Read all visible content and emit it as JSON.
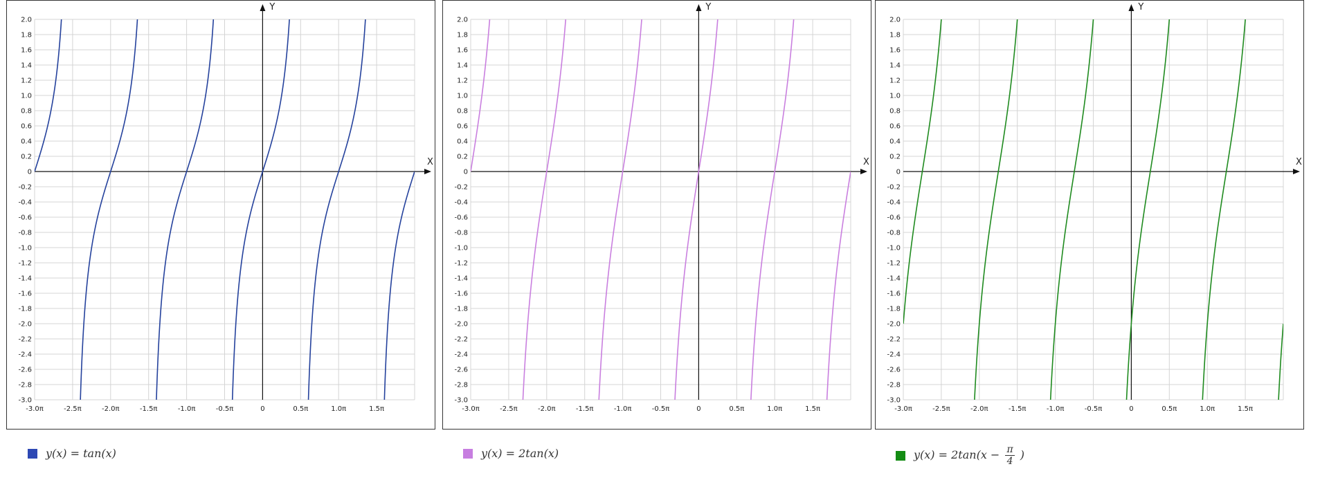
{
  "axis_labels": {
    "x": "X",
    "y": "Y"
  },
  "chart_data": [
    {
      "type": "line",
      "function": "tan",
      "multiplier": 1,
      "phase_pi": 0,
      "xlim": [
        -3.0,
        2.0
      ],
      "ylim": [
        -3.0,
        2.0
      ],
      "grid": true,
      "x_tick_labels": [
        "-3.0π",
        "-2.5π",
        "-2.0π",
        "-1.5π",
        "-1.0π",
        "-0.5π",
        "0",
        "0.5π",
        "1.0π",
        "1.5π"
      ],
      "x_tick_values": [
        -3.0,
        -2.5,
        -2.0,
        -1.5,
        -1.0,
        -0.5,
        0,
        0.5,
        1.0,
        1.5
      ],
      "y_tick_labels": [
        "2.0",
        "1.8",
        "1.6",
        "1.4",
        "1.2",
        "1.0",
        "0.8",
        "0.6",
        "0.4",
        "0.2",
        "0",
        "-0.2",
        "-0.4",
        "-0.6",
        "-0.8",
        "-1.0",
        "-1.2",
        "-1.4",
        "-1.6",
        "-1.8",
        "-2.0",
        "-2.2",
        "-2.4",
        "-2.6",
        "-2.8",
        "-3.0"
      ],
      "y_tick_values": [
        2.0,
        1.8,
        1.6,
        1.4,
        1.2,
        1.0,
        0.8,
        0.6,
        0.4,
        0.2,
        0,
        -0.2,
        -0.4,
        -0.6,
        -0.8,
        -1.0,
        -1.2,
        -1.4,
        -1.6,
        -1.8,
        -2.0,
        -2.2,
        -2.4,
        -2.6,
        -2.8,
        -3.0
      ],
      "color": "#24419c",
      "legend": {
        "prefix": "y(x) = tan(x)",
        "frac_num": "",
        "frac_den": "",
        "suffix": "",
        "swatch_color": "#2d48b4"
      }
    },
    {
      "type": "line",
      "function": "tan",
      "multiplier": 2,
      "phase_pi": 0,
      "xlim": [
        -3.0,
        2.0
      ],
      "ylim": [
        -3.0,
        2.0
      ],
      "grid": true,
      "x_tick_labels": [
        "-3.0π",
        "-2.5π",
        "-2.0π",
        "-1.5π",
        "-1.0π",
        "-0.5π",
        "0",
        "0.5π",
        "1.0π",
        "1.5π"
      ],
      "x_tick_values": [
        -3.0,
        -2.5,
        -2.0,
        -1.5,
        -1.0,
        -0.5,
        0,
        0.5,
        1.0,
        1.5
      ],
      "y_tick_labels": [
        "2.0",
        "1.8",
        "1.6",
        "1.4",
        "1.2",
        "1.0",
        "0.8",
        "0.6",
        "0.4",
        "0.2",
        "0",
        "-0.2",
        "-0.4",
        "-0.6",
        "-0.8",
        "-1.0",
        "-1.2",
        "-1.4",
        "-1.6",
        "-1.8",
        "-2.0",
        "-2.2",
        "-2.4",
        "-2.6",
        "-2.8",
        "-3.0"
      ],
      "y_tick_values": [
        2.0,
        1.8,
        1.6,
        1.4,
        1.2,
        1.0,
        0.8,
        0.6,
        0.4,
        0.2,
        0,
        -0.2,
        -0.4,
        -0.6,
        -0.8,
        -1.0,
        -1.2,
        -1.4,
        -1.6,
        -1.8,
        -2.0,
        -2.2,
        -2.4,
        -2.6,
        -2.8,
        -3.0
      ],
      "color": "#c97fdf",
      "legend": {
        "prefix": "y(x) = 2tan(x)",
        "frac_num": "",
        "frac_den": "",
        "suffix": "",
        "swatch_color": "#c77ee0"
      }
    },
    {
      "type": "line",
      "function": "tan",
      "multiplier": 2,
      "phase_pi": -0.25,
      "xlim": [
        -3.0,
        2.0
      ],
      "ylim": [
        -3.0,
        2.0
      ],
      "grid": true,
      "x_tick_labels": [
        "-3.0π",
        "-2.5π",
        "-2.0π",
        "-1.5π",
        "-1.0π",
        "-0.5π",
        "0",
        "0.5π",
        "1.0π",
        "1.5π"
      ],
      "x_tick_values": [
        -3.0,
        -2.5,
        -2.0,
        -1.5,
        -1.0,
        -0.5,
        0,
        0.5,
        1.0,
        1.5
      ],
      "y_tick_labels": [
        "2.0",
        "1.8",
        "1.6",
        "1.4",
        "1.2",
        "1.0",
        "0.8",
        "0.6",
        "0.4",
        "0.2",
        "0",
        "-0.2",
        "-0.4",
        "-0.6",
        "-0.8",
        "-1.0",
        "-1.2",
        "-1.4",
        "-1.6",
        "-1.8",
        "-2.0",
        "-2.2",
        "-2.4",
        "-2.6",
        "-2.8",
        "-3.0"
      ],
      "y_tick_values": [
        2.0,
        1.8,
        1.6,
        1.4,
        1.2,
        1.0,
        0.8,
        0.6,
        0.4,
        0.2,
        0,
        -0.2,
        -0.4,
        -0.6,
        -0.8,
        -1.0,
        -1.2,
        -1.4,
        -1.6,
        -1.8,
        -2.0,
        -2.2,
        -2.4,
        -2.6,
        -2.8,
        -3.0
      ],
      "color": "#1e8a1e",
      "legend": {
        "prefix": "y(x) = 2tan(x −",
        "frac_num": "π",
        "frac_den": "4",
        "suffix": ")",
        "swatch_color": "#148c14"
      }
    }
  ]
}
